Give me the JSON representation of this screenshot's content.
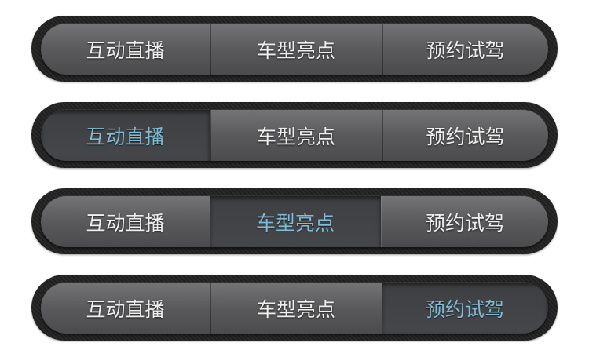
{
  "tabs": [
    "互动直播",
    "车型亮点",
    "预约试驾"
  ],
  "bars": [
    {
      "active": -1
    },
    {
      "active": 0
    },
    {
      "active": 1
    },
    {
      "active": 2
    }
  ],
  "colors": {
    "active_text": "#7fbcd6",
    "inactive_text": "#eeeeee"
  }
}
